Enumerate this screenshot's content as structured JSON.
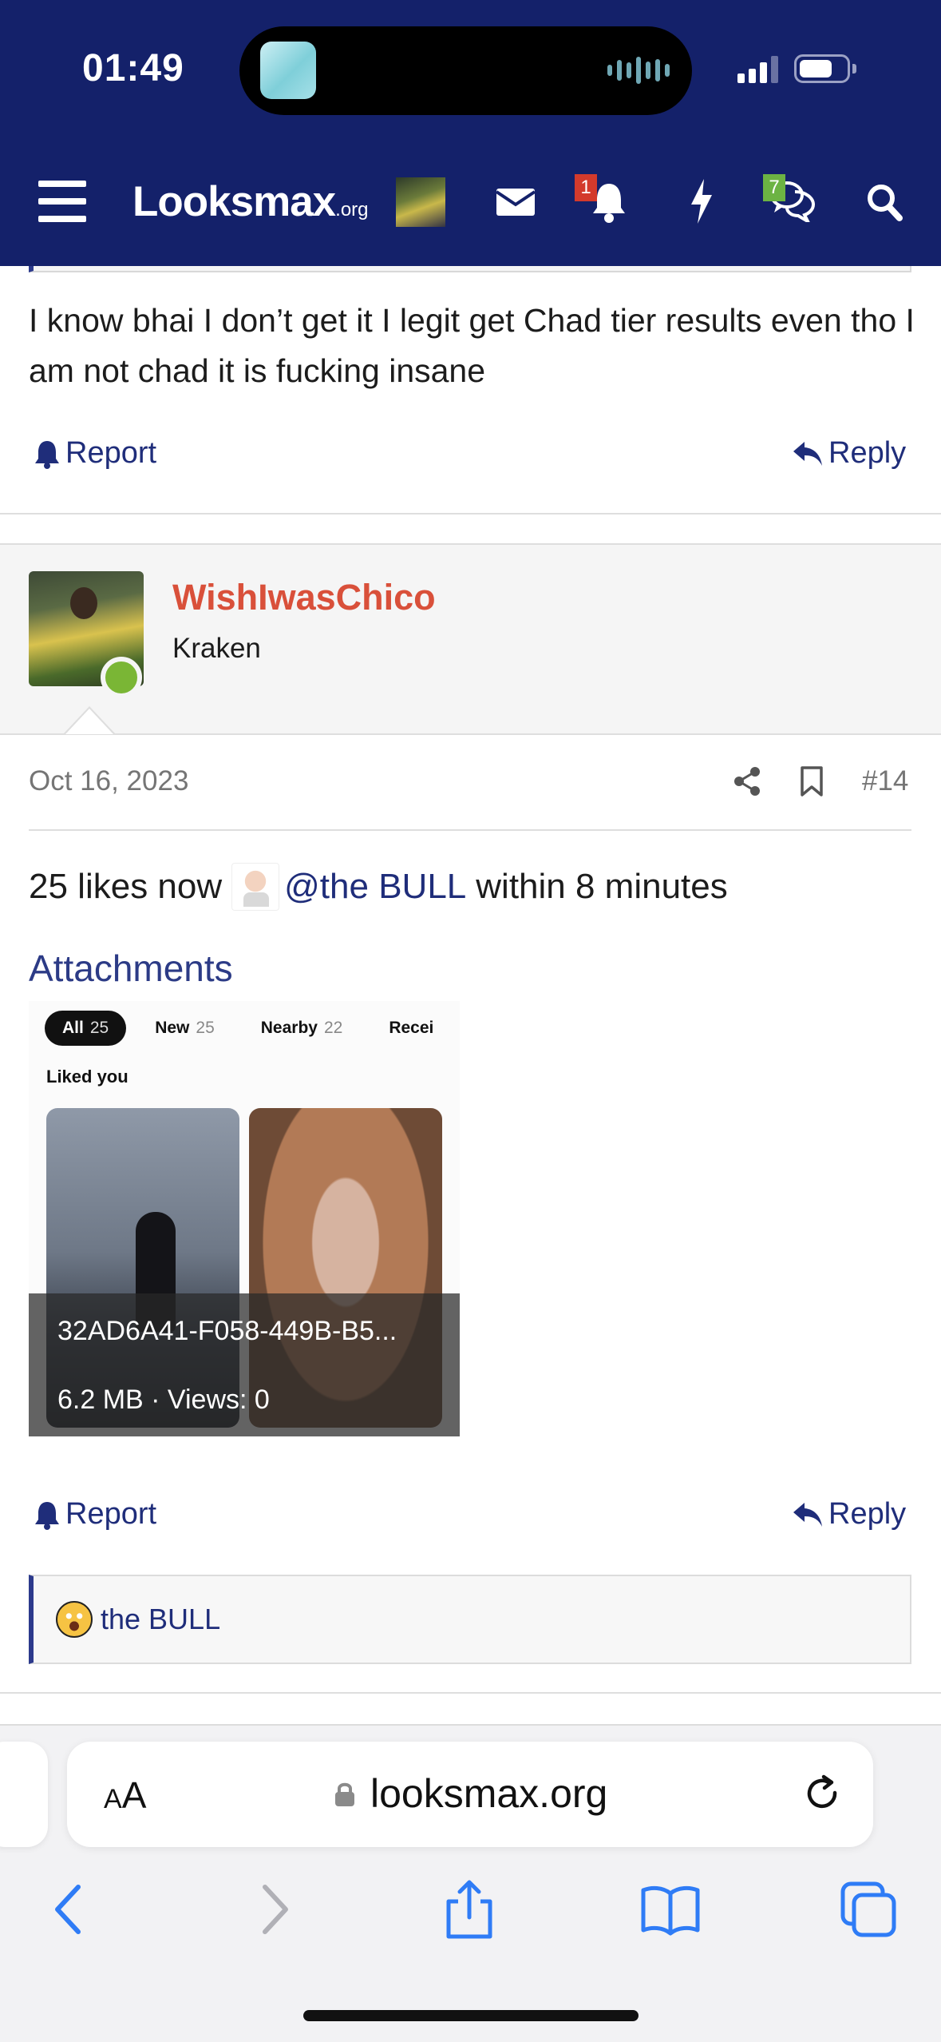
{
  "status_bar": {
    "time": "01:49"
  },
  "site_nav": {
    "logo_main": "Looksmax",
    "logo_suffix": ".org",
    "icons": [
      "menu-icon",
      "user-avatar",
      "envelope-icon",
      "bell-icon",
      "lightning-icon",
      "chat-bubbles-icon",
      "search-icon"
    ],
    "alerts_badge": "1",
    "conversations_badge": "7",
    "colors": {
      "nav_bg": "#14216a",
      "alert_badge": "#d33a2c",
      "conversation_badge": "#6cb343"
    }
  },
  "previous_post": {
    "text": "I know bhai I don’t get it I legit get Chad tier results even tho I am not chad it is fucking insane",
    "report_label": "Report",
    "reply_label": "Reply"
  },
  "post": {
    "username": "WishIwasChico",
    "user_title": "Kraken",
    "date": "Oct 16, 2023",
    "number": "#14",
    "body_before": "25 likes now",
    "mention": "@the BULL",
    "body_after": "within 8 minutes",
    "attachments_heading": "Attachments",
    "attachment": {
      "tabs": [
        {
          "label": "All",
          "count": "25"
        },
        {
          "label": "New",
          "count": "25"
        },
        {
          "label": "Nearby",
          "count": "22"
        },
        {
          "label": "Recei",
          "count": ""
        }
      ],
      "liked_heading": "Liked you",
      "filename": "32AD6A41-F058-449B-B5...",
      "meta": "6.2 MB · Views: 0"
    },
    "report_label": "Report",
    "reply_label": "Reply",
    "reaction_user": "the BULL",
    "colors": {
      "username": "#d9503a",
      "link": "#1f2d7a"
    }
  },
  "browser": {
    "text_size_label": "AA",
    "url": "looksmax.org",
    "toolbar_icons": [
      "back-icon",
      "forward-icon",
      "share-icon",
      "bookmarks-icon",
      "tabs-icon"
    ]
  }
}
